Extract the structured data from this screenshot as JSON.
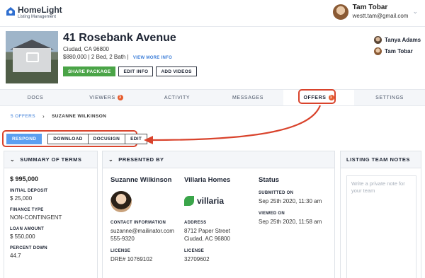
{
  "app": {
    "brand": "HomeLight",
    "subtitle": "Listing Management"
  },
  "user": {
    "name": "Tam Tobar",
    "email": "westt.tam@gmail.com"
  },
  "property": {
    "address": "41 Rosebank Avenue",
    "city_line": "Ciudad, CA 96800",
    "details": "$880,000 | 2 Bed, 2 Bath |",
    "view_more": "VIEW MORE INFO",
    "buttons": {
      "share": "SHARE PACKAGE",
      "edit": "EDIT INFO",
      "add_videos": "ADD VIDEOS"
    }
  },
  "team": [
    {
      "name": "Tanya Adams"
    },
    {
      "name": "Tam Tobar"
    }
  ],
  "tabs": [
    {
      "label": "DOCS",
      "badge": ""
    },
    {
      "label": "VIEWERS",
      "badge": "3"
    },
    {
      "label": "ACTIVITY",
      "badge": ""
    },
    {
      "label": "MESSAGES",
      "badge": ""
    },
    {
      "label": "OFFERS",
      "badge": "1"
    },
    {
      "label": "SETTINGS",
      "badge": ""
    }
  ],
  "breadcrumb": {
    "parent": "5 OFFERS",
    "current": "SUZANNE WILKINSON"
  },
  "actions": {
    "respond": "RESPOND",
    "download": "DOWNLOAD",
    "docusign": "DOCUSIGN",
    "edit": "EDIT"
  },
  "summary": {
    "title": "SUMMARY OF TERMS",
    "price": "$ 995,000",
    "rows": [
      {
        "label": "INITIAL DEPOSIT",
        "value": "$ 25,000"
      },
      {
        "label": "FINANCE TYPE",
        "value": "NON-CONTINGENT"
      },
      {
        "label": "LOAN AMOUNT",
        "value": "$ 550,000"
      },
      {
        "label": "PERCENT DOWN",
        "value": "44.7"
      }
    ]
  },
  "presented": {
    "title": "PRESENTED BY",
    "agent": {
      "name": "Suzanne Wilkinson",
      "contact_label": "CONTACT INFORMATION",
      "email": "suzanne@mailinator.com",
      "phone": "555-9320",
      "license_label": "LICENSE",
      "license": "DRE# 10769102"
    },
    "brokerage": {
      "name": "Villaria Homes",
      "logo_text": "villaria",
      "address_label": "ADDRESS",
      "address1": "8712 Paper Street",
      "address2": "Ciudad, AC 96800",
      "license_label": "LICENSE",
      "license": "32709602"
    },
    "status": {
      "title": "Status",
      "submitted_label": "SUBMITTED ON",
      "submitted": "Sep 25th 2020, 11:30 am",
      "viewed_label": "VIEWED ON",
      "viewed": "Sep 25th 2020, 11:58 am"
    }
  },
  "notes": {
    "title": "LISTING TEAM NOTES",
    "placeholder": "Write a private note for your team"
  },
  "colors": {
    "accent_blue": "#3b7dd8",
    "green": "#4aa447",
    "annotation_red": "#d9432c",
    "badge_orange": "#e55b2d"
  }
}
